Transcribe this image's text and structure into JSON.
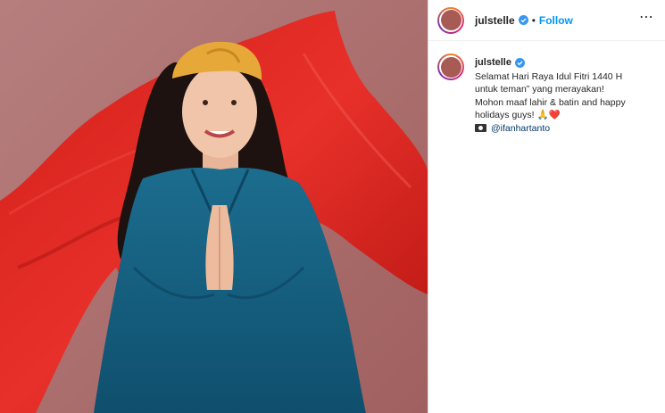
{
  "post": {
    "username": "julstelle",
    "follow_label": "Follow",
    "separator": "•",
    "more_icon": "⋯",
    "caption": {
      "username": "julstelle",
      "text": "Selamat Hari Raya Idul Fitri 1440 H\nuntuk teman” yang merayakan!\nMohon maaf lahir & batin and happy\nholidays guys! 🙏❤️",
      "credit_icon": "camera-icon",
      "mention": "@ifanhartanto"
    }
  },
  "colors": {
    "link_blue": "#0095f6",
    "mention_blue": "#00376b",
    "background_photo": "#b07a79"
  }
}
